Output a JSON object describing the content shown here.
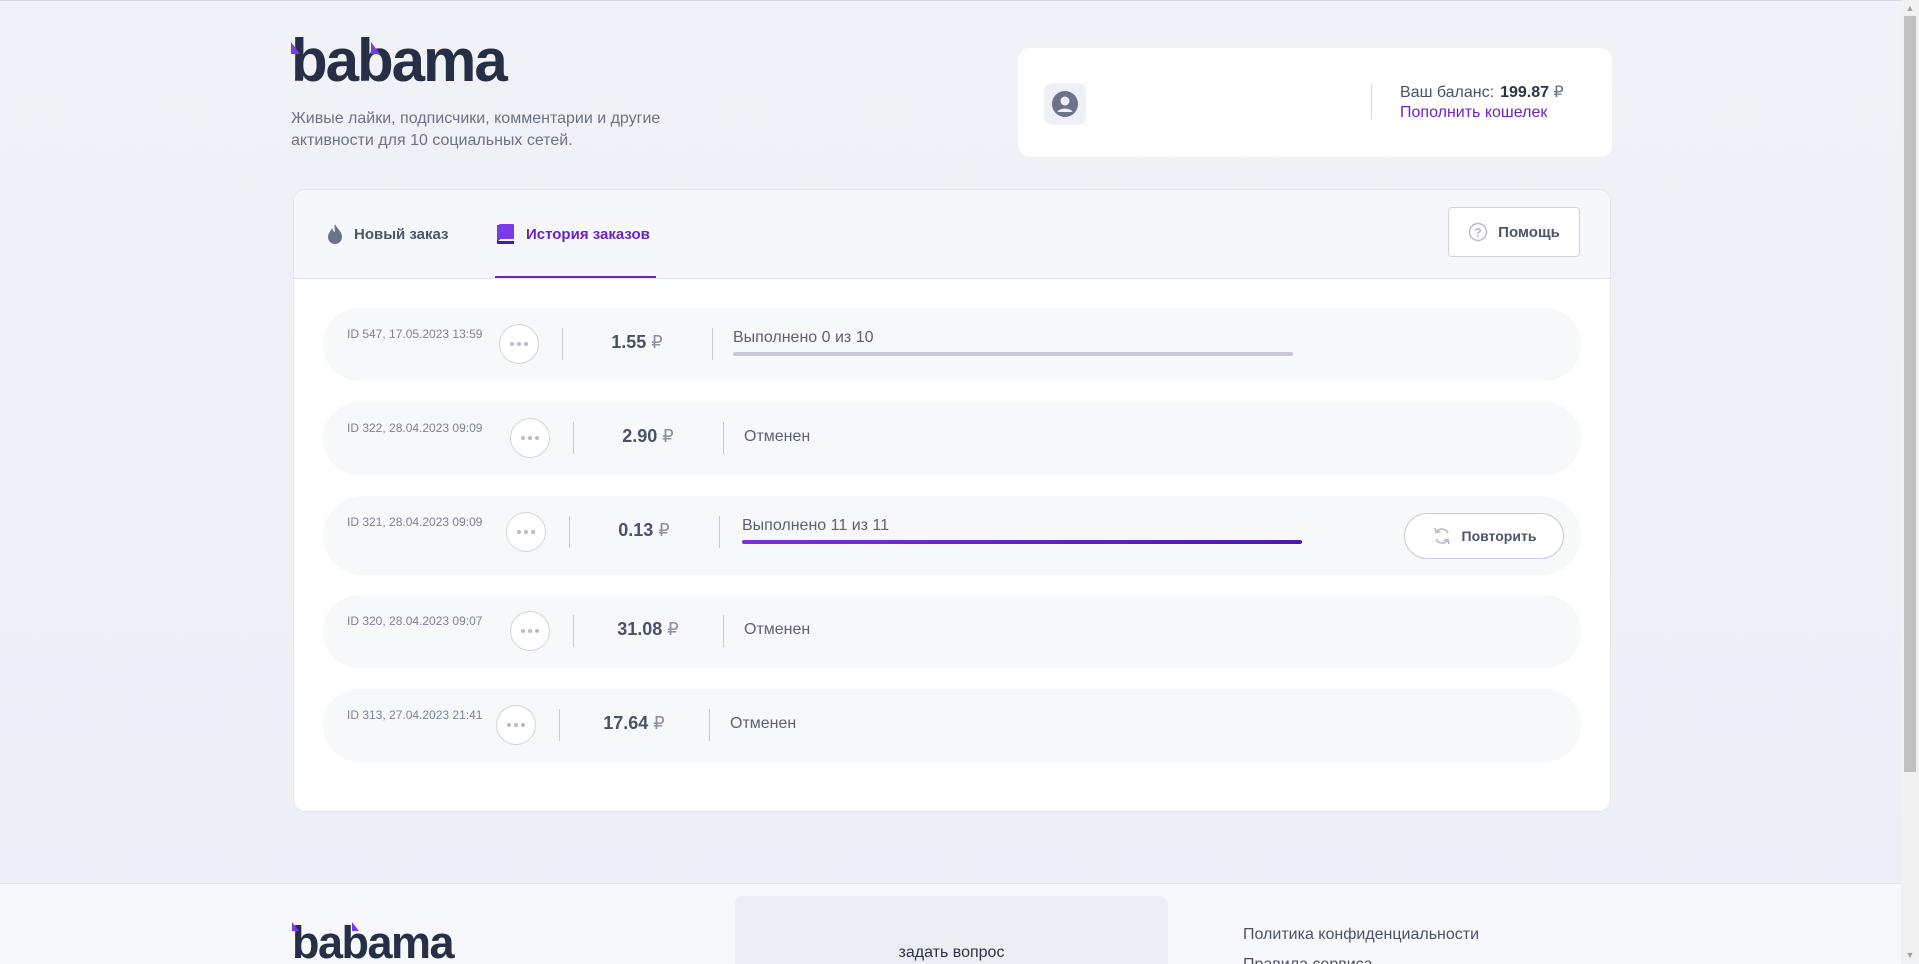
{
  "brand": {
    "logo_text": "babama",
    "tagline": "Живые лайки, подписчики, комментарии и другие активности для 10 социальных сетей.",
    "accent_color": "#6a24c6"
  },
  "balance": {
    "label": "Ваш баланс:",
    "amount": "199.87",
    "currency": "₽",
    "topup_link": "Пополнить кошелек"
  },
  "tabs": [
    {
      "label": "Новый заказ",
      "icon": "flame-icon",
      "active": false
    },
    {
      "label": "История заказов",
      "icon": "book-icon",
      "active": true
    }
  ],
  "help_button": {
    "label": "Помощь",
    "icon": "question-circle-icon"
  },
  "currency_symbol": "₽",
  "orders": [
    {
      "id_text": "ID 547, 17.05.2023 13:59",
      "price": "1.55",
      "status": "Выполнено 0 из 10",
      "progress": 0.0
    },
    {
      "id_text": "ID 322, 28.04.2023 09:09",
      "price": "2.90",
      "status": "Отменен"
    },
    {
      "id_text": "ID 321, 28.04.2023 09:09",
      "price": "0.13",
      "status": "Выполнено 11 из 11",
      "progress": 1.0,
      "action": "Повторить"
    },
    {
      "id_text": "ID 320, 28.04.2023 09:07",
      "price": "31.08",
      "status": "Отменен"
    },
    {
      "id_text": "ID 313, 27.04.2023 21:41",
      "price": "17.64",
      "status": "Отменен"
    }
  ],
  "footer": {
    "logo_text": "babama",
    "ask_question": "задать вопрос",
    "links": [
      "Политика конфиденциальности",
      "Правила сервиса"
    ]
  }
}
